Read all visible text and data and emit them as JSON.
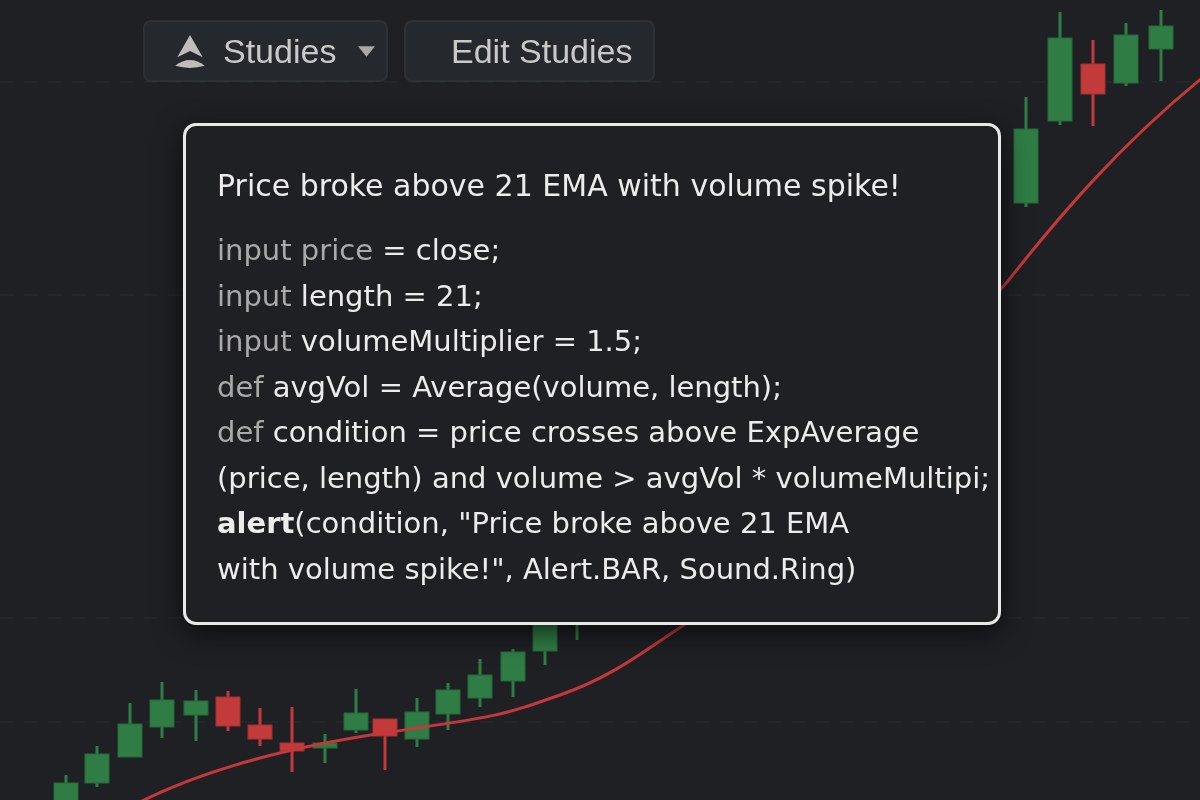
{
  "toolbar": [
    {
      "kind": "dropdown",
      "label": "Studies"
    },
    {
      "kind": "button",
      "label": "Edit Studies"
    }
  ],
  "alert_popup": {
    "title": "Price broke above 21 EMA with volume spike!",
    "code_lines": [
      {
        "keyword": "input price",
        "code": "= close;"
      },
      {
        "keyword": "input",
        "code": "length = 21;"
      },
      {
        "keyword": "input",
        "code": "volumeMultiplier = 1.5;"
      },
      {
        "keyword": "def",
        "code": "avgVol = Average(volume, length);"
      },
      {
        "keyword": "def",
        "code": "condition = price crosses above ExpAverage"
      },
      {
        "code": "(price, length) and volume > avgVol * volumeMultipi;"
      },
      {
        "code": "**alert**(condition, \"Price broke above 21 EMA"
      },
      {
        "code": "with volume spike!\", Alert.BAR, Sound.Ring)"
      }
    ]
  }
}
